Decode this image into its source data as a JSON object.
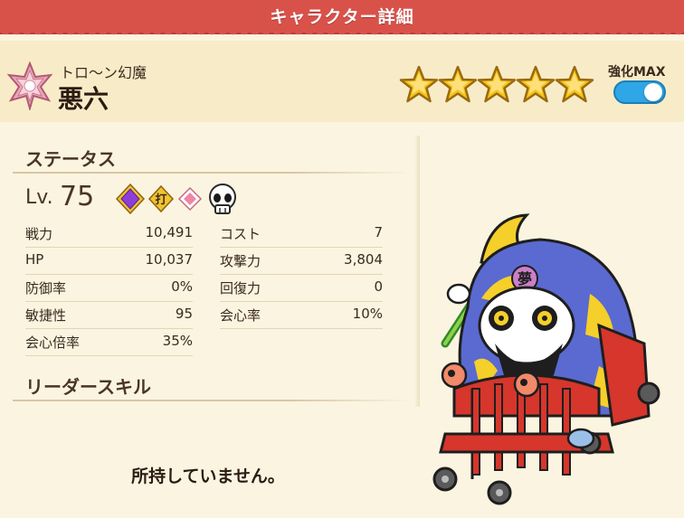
{
  "banner": {
    "title": "キャラクター詳細"
  },
  "header": {
    "kana": "トロ〜ン幻魔",
    "name": "悪六",
    "rarity_icon": "flower-badge-icon",
    "star_count": 5,
    "max_label": "強化MAX",
    "max_toggle_on": true
  },
  "status": {
    "title": "ステータス",
    "lv_label": "Lv.",
    "lv_value": "75",
    "trait_icons": [
      "purple-gem-icon",
      "strike-attribute-icon",
      "pink-diamond-icon",
      "skull-tribe-icon"
    ],
    "trait_strike_text": "打",
    "left": [
      {
        "label": "戦力",
        "value": "10,491"
      },
      {
        "label": "HP",
        "value": "10,037"
      },
      {
        "label": "防御率",
        "value": "0%"
      },
      {
        "label": "敏捷性",
        "value": "95"
      },
      {
        "label": "会心倍率",
        "value": "35%"
      }
    ],
    "right": [
      {
        "label": "コスト",
        "value": "7"
      },
      {
        "label": "攻撃力",
        "value": "3,804"
      },
      {
        "label": "回復力",
        "value": "0"
      },
      {
        "label": "会心率",
        "value": "10%"
      }
    ]
  },
  "leader_skill": {
    "title": "リーダースキル",
    "empty_text": "所持していません。"
  },
  "character_image": {
    "icon": "skeleton-on-chair-illustration",
    "emblem_text": "夢"
  },
  "colors": {
    "banner": "#d9524a",
    "accent_star": "#f5c518",
    "toggle": "#2fa6e6"
  }
}
